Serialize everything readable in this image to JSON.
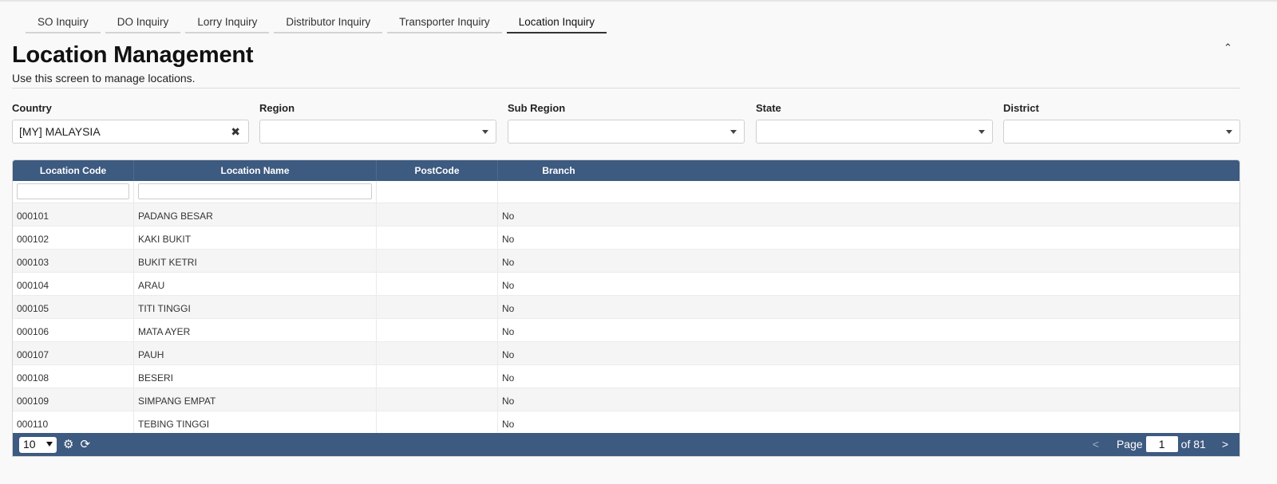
{
  "tabs": [
    {
      "label": "SO Inquiry",
      "active": false
    },
    {
      "label": "DO Inquiry",
      "active": false
    },
    {
      "label": "Lorry Inquiry",
      "active": false
    },
    {
      "label": "Distributor Inquiry",
      "active": false
    },
    {
      "label": "Transporter Inquiry",
      "active": false
    },
    {
      "label": "Location Inquiry",
      "active": true
    }
  ],
  "page": {
    "title": "Location Management",
    "subtitle": "Use this screen to manage locations.",
    "collapse_glyph": "⌃"
  },
  "filters": {
    "country": {
      "label": "Country",
      "value": "[MY] MALAYSIA",
      "clear_glyph": "✖"
    },
    "region": {
      "label": "Region",
      "value": ""
    },
    "sub_region": {
      "label": "Sub Region",
      "value": ""
    },
    "state": {
      "label": "State",
      "value": ""
    },
    "district": {
      "label": "District",
      "value": ""
    }
  },
  "grid": {
    "columns": [
      "Location Code",
      "Location Name",
      "PostCode",
      "Branch"
    ],
    "rows": [
      {
        "code": "000101",
        "name": "PADANG BESAR",
        "postcode": "",
        "branch": "No"
      },
      {
        "code": "000102",
        "name": "KAKI BUKIT",
        "postcode": "",
        "branch": "No"
      },
      {
        "code": "000103",
        "name": "BUKIT KETRI",
        "postcode": "",
        "branch": "No"
      },
      {
        "code": "000104",
        "name": "ARAU",
        "postcode": "",
        "branch": "No"
      },
      {
        "code": "000105",
        "name": "TITI TINGGI",
        "postcode": "",
        "branch": "No"
      },
      {
        "code": "000106",
        "name": "MATA AYER",
        "postcode": "",
        "branch": "No"
      },
      {
        "code": "000107",
        "name": "PAUH",
        "postcode": "",
        "branch": "No"
      },
      {
        "code": "000108",
        "name": "BESERI",
        "postcode": "",
        "branch": "No"
      },
      {
        "code": "000109",
        "name": "SIMPANG EMPAT",
        "postcode": "",
        "branch": "No"
      },
      {
        "code": "000110",
        "name": "TEBING TINGGI",
        "postcode": "",
        "branch": "No"
      }
    ]
  },
  "footer": {
    "page_size": "10",
    "settings_glyph": "⚙",
    "refresh_glyph": "⟳",
    "prev_glyph": "<",
    "next_glyph": ">",
    "page_label": "Page",
    "current_page": "1",
    "total_label": "of 81"
  },
  "colors": {
    "header_bg": "#3d5a80",
    "row_alt_bg": "#f5f5f5"
  }
}
